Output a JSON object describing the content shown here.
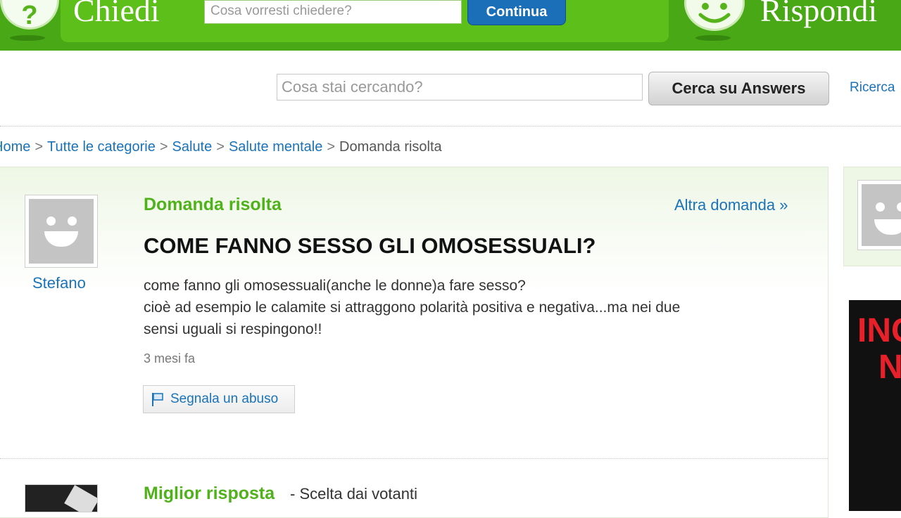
{
  "header": {
    "ask_brand": "Chiedi",
    "ask_placeholder": "Cosa vorresti chiedere?",
    "continue_label": "Continua",
    "answer_brand": "Rispondi"
  },
  "search": {
    "placeholder": "Cosa stai cercando?",
    "button_label": "Cerca su Answers",
    "advanced_label": "Ricerca"
  },
  "breadcrumb": {
    "items": [
      "Home",
      "Tutte le categorie",
      "Salute",
      "Salute mentale"
    ],
    "current": "Domanda risolta",
    "separator": ">"
  },
  "question": {
    "asker": "Stefano",
    "status": "Domanda risolta",
    "other_question": "Altra domanda »",
    "title": "COME FANNO SESSO GLI OMOSESSUALI?",
    "body_lines": [
      "come fanno gli omosessuali(anche le donne)a fare sesso?",
      "cioè ad esempio le calamite si attraggono polarità positiva e negativa...ma nei due",
      "sensi uguali si respingono!!"
    ],
    "time": "3 mesi fa",
    "report_label": "Segnala un abuso"
  },
  "best_answer": {
    "label": "Miglior risposta",
    "subtitle": "- Scelta dai votanti"
  },
  "ad": {
    "lines": [
      "INC",
      "NE"
    ]
  },
  "colors": {
    "brand_green": "#48a816",
    "status_green": "#50b21a",
    "link_blue": "#1a73b8",
    "button_blue": "#1b6fb8",
    "ad_red": "#e8202a"
  }
}
